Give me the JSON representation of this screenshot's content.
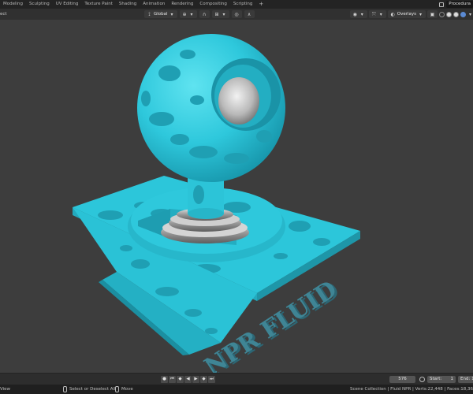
{
  "topbar": {
    "tabs": [
      "Modeling",
      "Sculpting",
      "UV Editing",
      "Texture Paint",
      "Shading",
      "Animation",
      "Rendering",
      "Compositing",
      "Scripting"
    ],
    "add_tab": "+",
    "scene_name": "Procedura"
  },
  "viewport_header": {
    "select_label": "ect",
    "orientation": "Global",
    "overlays_label": "Overlays"
  },
  "viewport": {
    "watermark_text": "NPR FLUID",
    "colors": {
      "background": "#3d3d3d",
      "fluid": "#2ec8dc",
      "fluid_dark": "#1b9fb4",
      "metal": "#b9b9b9",
      "watermark": "#3f8595"
    }
  },
  "timeline": {
    "current_frame": "576",
    "start_label": "Start:",
    "start_value": "1",
    "end_label": "End:",
    "end_value": "1"
  },
  "statusbar": {
    "left_label": "View",
    "select_hint": "Select or Deselect All",
    "move_hint": "Move",
    "stats": "Scene Collection | Fluid NPR | Verts:22,448 | Faces:18,36"
  }
}
